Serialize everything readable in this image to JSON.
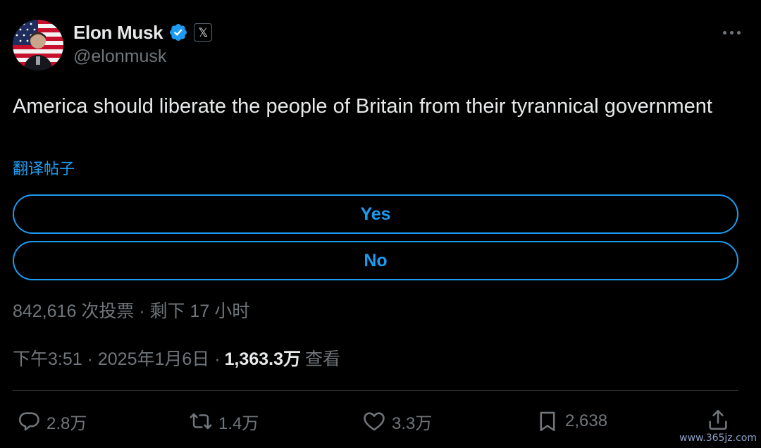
{
  "author": {
    "display_name": "Elon Musk",
    "handle": "@elonmusk",
    "verified": true,
    "affiliation_badge": "𝕏"
  },
  "tweet": {
    "text": "America should liberate the people of Britain from their tyrannical government",
    "translate_link": "翻译帖子"
  },
  "poll": {
    "options": [
      {
        "label": "Yes"
      },
      {
        "label": "No"
      }
    ],
    "meta": "842,616 次投票 · 剩下 17 小时"
  },
  "timestamp": {
    "time_date": "下午3:51 · 2025年1月6日 ·",
    "views_count": "1,363.3万",
    "views_label": "查看"
  },
  "actions": {
    "reply_count": "2.8万",
    "retweet_count": "1.4万",
    "like_count": "3.3万",
    "bookmark_count": "2,638"
  },
  "watermark": "www.365jz.com",
  "colors": {
    "background": "#000000",
    "accent": "#1d9bf0",
    "primary_text": "#e7e9ea",
    "secondary_text": "#71767b"
  },
  "icons": [
    "verified-badge-icon",
    "x-logo-icon",
    "more-icon",
    "reply-icon",
    "retweet-icon",
    "like-icon",
    "bookmark-icon",
    "share-icon"
  ]
}
